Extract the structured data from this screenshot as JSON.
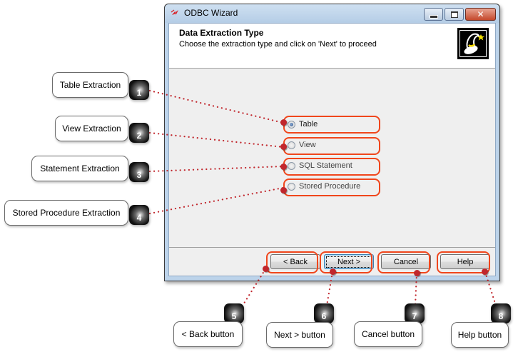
{
  "window": {
    "title": "ODBC Wizard",
    "app_icon": "odbc-wizard-app-icon",
    "controls": {
      "minimize": "minimize-icon",
      "maximize": "maximize-icon",
      "close": "close-icon",
      "close_glyph": "✕"
    }
  },
  "header": {
    "title": "Data Extraction Type",
    "subtitle": "Choose the extraction type and click on 'Next' to proceed",
    "logo": "wizard-hat-icon"
  },
  "options": [
    {
      "label": "Table",
      "selected": true
    },
    {
      "label": "View",
      "selected": false
    },
    {
      "label": "SQL Statement",
      "selected": false
    },
    {
      "label": "Stored Procedure",
      "selected": false
    }
  ],
  "buttons": {
    "back": "< Back",
    "next": "Next >",
    "cancel": "Cancel",
    "help": "Help"
  },
  "annotations": [
    {
      "number": "1",
      "label": "Table Extraction"
    },
    {
      "number": "2",
      "label": "View Extraction"
    },
    {
      "number": "3",
      "label": "Statement Extraction"
    },
    {
      "number": "4",
      "label": "Stored Procedure Extraction"
    },
    {
      "number": "5",
      "label": "< Back button"
    },
    {
      "number": "6",
      "label": "Next > button"
    },
    {
      "number": "7",
      "label": "Cancel button"
    },
    {
      "number": "8",
      "label": "Help button"
    }
  ],
  "colors": {
    "highlight": "#f0461c",
    "connector": "#c1272d"
  }
}
